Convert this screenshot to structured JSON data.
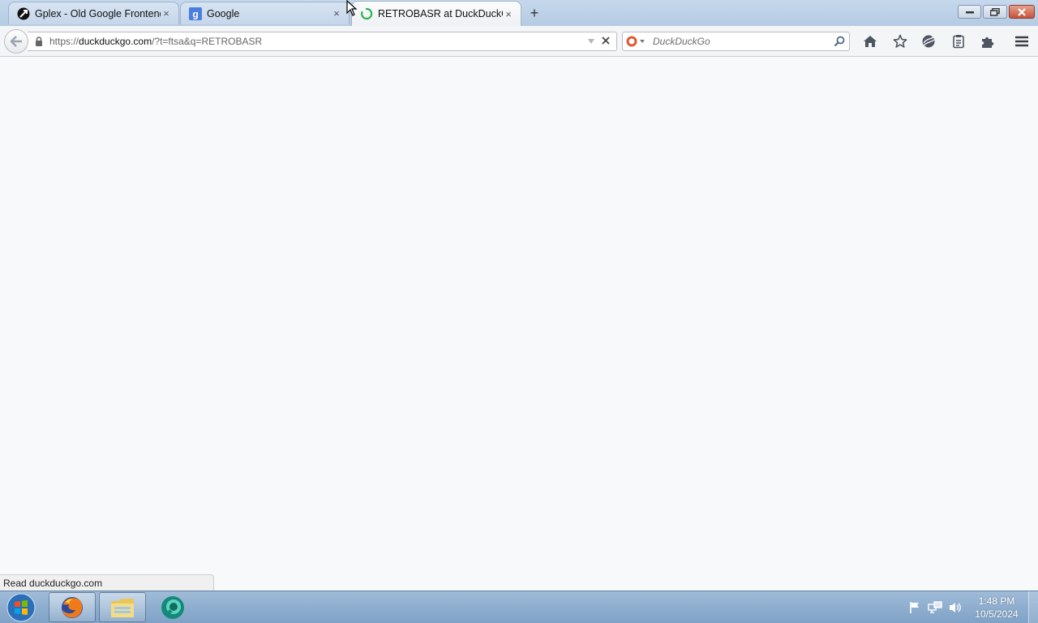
{
  "browser": {
    "tabs": [
      {
        "title": "Gplex - Old Google Frontend",
        "favicon": "gplex-icon",
        "active": false
      },
      {
        "title": "Google",
        "favicon": "google-icon",
        "active": false
      },
      {
        "title": "RETROBASR at DuckDuckGo",
        "favicon": "loading-spinner-icon",
        "active": true
      }
    ],
    "new_tab_label": "+",
    "close_glyph": "×",
    "url": {
      "prefix": "https://",
      "domain": "duckduckgo.com",
      "path": "/?t=ftsa&q=RETROBASR"
    },
    "search": {
      "placeholder": "DuckDuckGo",
      "engine_icon": "duckduckgo-icon"
    },
    "toolbar_icons": [
      "home-icon",
      "bookmark-star-icon",
      "sync-icon",
      "reading-list-icon",
      "addons-icon",
      "menu-icon"
    ]
  },
  "status_bar": {
    "text": "Read duckduckgo.com"
  },
  "taskbar": {
    "items": [
      "firefox-icon",
      "file-explorer-icon",
      "app-icon"
    ],
    "clock": {
      "time": "1:48 PM",
      "date": "10/5/2024"
    }
  },
  "colors": {
    "taskbar": "#8fb0d2",
    "content_background": "#f8f9fa",
    "loading_spinner": "#2bb14a",
    "duckduckgo_red": "#de5833"
  }
}
